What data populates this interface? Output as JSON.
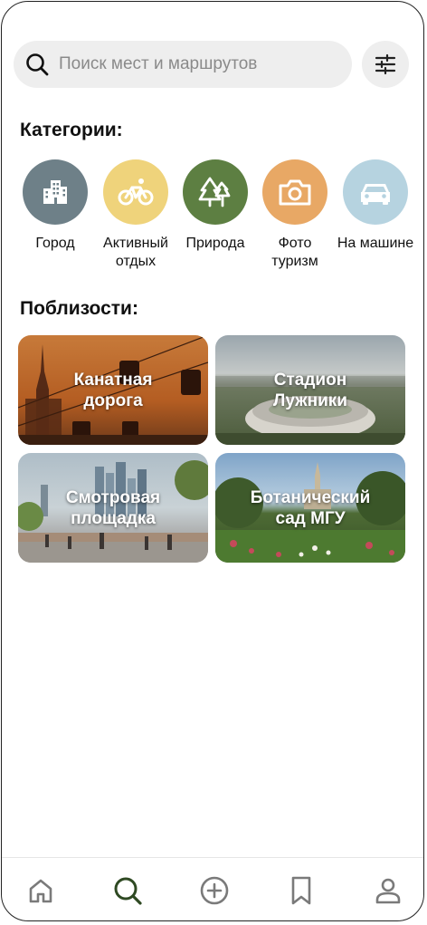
{
  "search": {
    "placeholder": "Поиск мест и маршрутов",
    "icon": "search-icon"
  },
  "filter": {
    "icon": "sliders-icon"
  },
  "categories": {
    "title": "Категории:",
    "items": [
      {
        "label": "Город",
        "icon": "city-buildings-icon",
        "color": "#6e8088"
      },
      {
        "label": "Активный отдых",
        "icon": "bicycle-icon",
        "color": "#efd37b"
      },
      {
        "label": "Природа",
        "icon": "trees-icon",
        "color": "#5d7f42"
      },
      {
        "label": "Фото туризм",
        "icon": "camera-icon",
        "color": "#e8a865"
      },
      {
        "label": "На машине",
        "icon": "car-icon",
        "color": "#b6d3e0"
      }
    ]
  },
  "nearby": {
    "title": "Поблизости:",
    "items": [
      {
        "label": "Канатная дорога"
      },
      {
        "label": "Стадион Лужники"
      },
      {
        "label": "Смотровая площадка"
      },
      {
        "label": "Ботанический сад МГУ"
      }
    ]
  },
  "tabbar": {
    "items": [
      {
        "icon": "home-icon",
        "active": false
      },
      {
        "icon": "search-icon",
        "active": true
      },
      {
        "icon": "add-circle-icon",
        "active": false
      },
      {
        "icon": "bookmark-icon",
        "active": false
      },
      {
        "icon": "profile-icon",
        "active": false
      }
    ],
    "active_color": "#2f4a23",
    "inactive_color": "#7a7a7a"
  }
}
